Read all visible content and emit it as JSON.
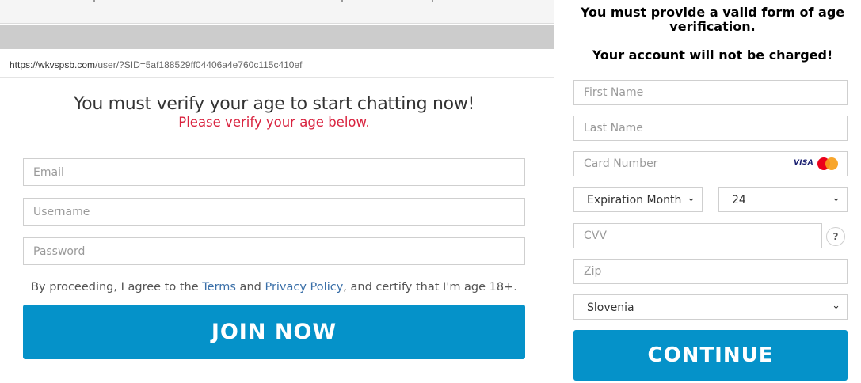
{
  "browser": {
    "url_host": "https://wkvspsb.com",
    "url_path": "/user/?SID=5af188529ff04406a4e760c115c410ef"
  },
  "left": {
    "headline": "You must verify your age to start chatting now!",
    "subline": "Please verify your age below.",
    "email_placeholder": "Email",
    "username_placeholder": "Username",
    "password_placeholder": "Password",
    "consent_prefix": "By proceeding, I agree to the ",
    "terms_link": "Terms",
    "consent_and": " and ",
    "privacy_link": "Privacy Policy",
    "consent_suffix": ", and certify that I'm age 18+.",
    "join_button": "JOIN NOW"
  },
  "right": {
    "title": "You must provide a valid form of age verification.",
    "subtitle": "Your account will not be charged!",
    "first_name_placeholder": "First Name",
    "last_name_placeholder": "Last Name",
    "card_number_placeholder": "Card Number",
    "card_brands": [
      "VISA",
      "mastercard"
    ],
    "expiration_month": "Expiration Month",
    "expiration_year": "24",
    "cvv_placeholder": "CVV",
    "cvv_help": "?",
    "zip_placeholder": "Zip",
    "country": "Slovenia",
    "continue_button": "CONTINUE"
  },
  "colors": {
    "accent_button": "#0592c9",
    "subline_red": "#d9233f",
    "link_blue": "#3a6fa8"
  }
}
